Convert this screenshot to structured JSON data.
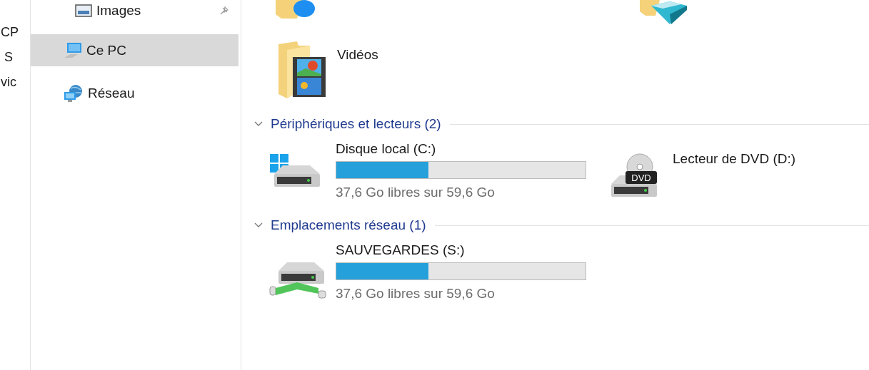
{
  "left_strip": [
    "CP",
    "S",
    "vic"
  ],
  "sidebar": {
    "items": [
      {
        "label": "Images",
        "kind": "pictures",
        "pinned": true,
        "selected": false
      },
      {
        "label": "Ce PC",
        "kind": "computer",
        "pinned": false,
        "selected": true
      },
      {
        "label": "Réseau",
        "kind": "network",
        "pinned": false,
        "selected": false
      }
    ]
  },
  "partial_folders": [
    {
      "kind": "badge-folder"
    },
    {
      "kind": "cube-folder"
    }
  ],
  "folders": [
    {
      "label": "Vidéos",
      "kind": "videos"
    }
  ],
  "groups": [
    {
      "title": "Périphériques et lecteurs (2)",
      "expanded": true,
      "items": [
        {
          "name": "Disque local (C:)",
          "kind": "system-drive",
          "level": 0.37,
          "free": "37,6 Go libres sur 59,6 Go"
        },
        {
          "name": "Lecteur de DVD (D:)",
          "kind": "dvd-drive",
          "disc_label": "DVD"
        }
      ]
    },
    {
      "title": "Emplacements réseau (1)",
      "expanded": true,
      "items": [
        {
          "name": "SAUVEGARDES (S:)",
          "kind": "network-drive",
          "level": 0.37,
          "free": "37,6 Go libres sur 59,6 Go"
        }
      ]
    }
  ]
}
